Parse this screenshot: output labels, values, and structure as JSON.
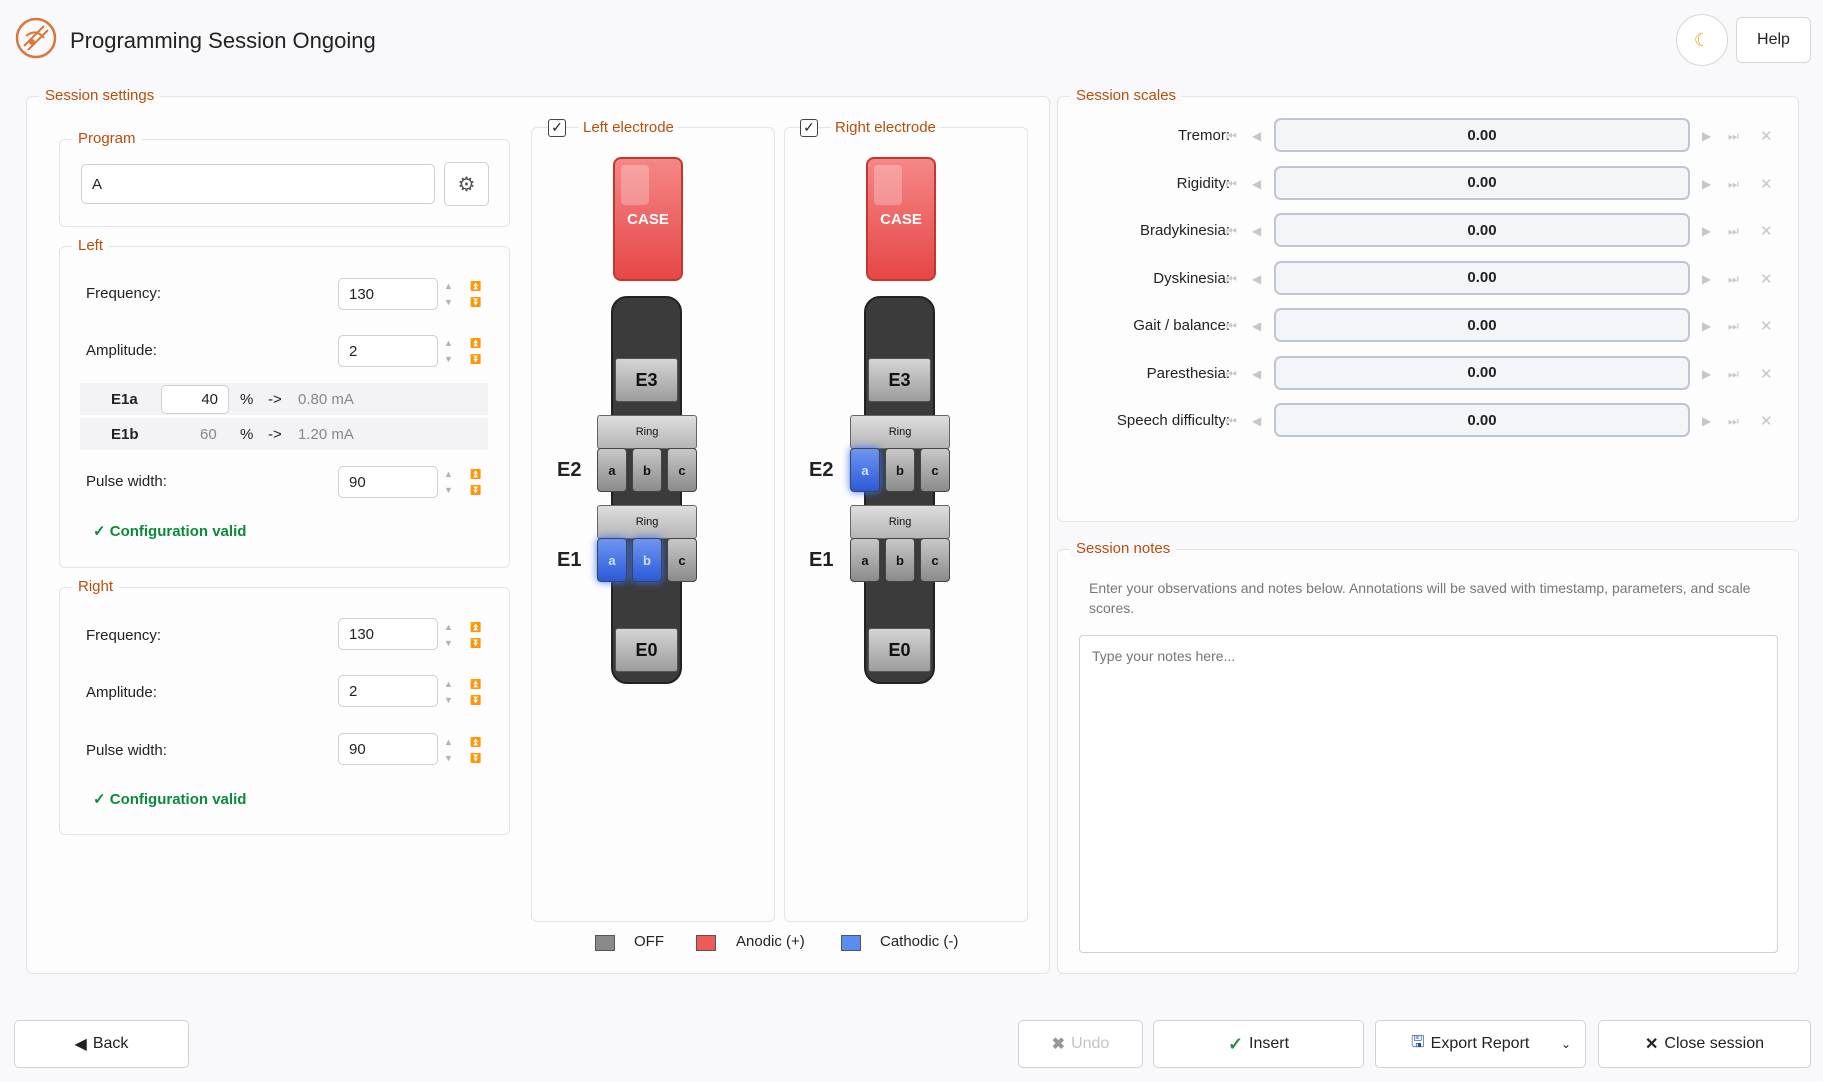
{
  "app": {
    "title": "Programming Session Ongoing",
    "help_label": "Help",
    "theme_icon": "moon-icon"
  },
  "session_settings": {
    "title": "Session settings",
    "program": {
      "title": "Program",
      "value": "A"
    },
    "left": {
      "title": "Left",
      "frequency_label": "Frequency:",
      "frequency": "130",
      "amplitude_label": "Amplitude:",
      "amplitude": "2",
      "rows": [
        {
          "contact": "E1a",
          "percent": "40",
          "unit": "%",
          "arrow": "->",
          "current": "0.80 mA"
        },
        {
          "contact": "E1b",
          "percent": "60",
          "unit": "%",
          "arrow": "->",
          "current": "1.20 mA"
        }
      ],
      "pulse_label": "Pulse width:",
      "pulse": "90",
      "status": "✓ Configuration valid"
    },
    "right": {
      "title": "Right",
      "frequency_label": "Frequency:",
      "frequency": "130",
      "amplitude_label": "Amplitude:",
      "amplitude": "2",
      "pulse_label": "Pulse width:",
      "pulse": "90",
      "status": "✓ Configuration valid"
    }
  },
  "electrodes": {
    "left": {
      "title": "Left electrode",
      "checked": true,
      "case": "CASE",
      "e3": "E3",
      "e2": "E2",
      "e1": "E1",
      "e0": "E0",
      "ring": "Ring",
      "cathodic": [
        "E1a",
        "E1b"
      ]
    },
    "right": {
      "title": "Right electrode",
      "checked": true,
      "case": "CASE",
      "e3": "E3",
      "e2": "E2",
      "e1": "E1",
      "e0": "E0",
      "ring": "Ring",
      "cathodic": [
        "E2a"
      ]
    },
    "segments": [
      "a",
      "b",
      "c"
    ],
    "legend": [
      {
        "label": "OFF",
        "color": "#8a8a8a"
      },
      {
        "label": "Anodic (+)",
        "color": "#ee5a5a"
      },
      {
        "label": "Cathodic (-)",
        "color": "#5b8cf0"
      }
    ]
  },
  "session_scales": {
    "title": "Session scales",
    "items": [
      {
        "label": "Tremor:",
        "value": "0.00"
      },
      {
        "label": "Rigidity:",
        "value": "0.00"
      },
      {
        "label": "Bradykinesia:",
        "value": "0.00"
      },
      {
        "label": "Dyskinesia:",
        "value": "0.00"
      },
      {
        "label": "Gait / balance:",
        "value": "0.00"
      },
      {
        "label": "Paresthesia:",
        "value": "0.00"
      },
      {
        "label": "Speech difficulty:",
        "value": "0.00"
      }
    ]
  },
  "session_notes": {
    "title": "Session notes",
    "hint": "Enter your observations and notes below. Annotations will be saved with timestamp, parameters, and scale scores.",
    "placeholder": "Type your notes here..."
  },
  "footer": {
    "back": "Back",
    "undo": "Undo",
    "insert": "Insert",
    "export": "Export Report",
    "close": "Close session"
  }
}
